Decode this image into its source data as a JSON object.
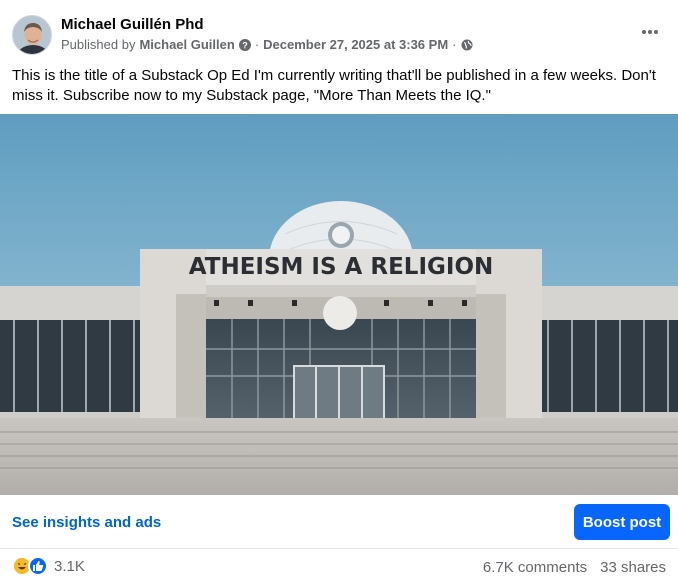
{
  "post": {
    "author": "Michael Guillén Phd",
    "published_by_prefix": "Published by",
    "published_by_name": "Michael Guillen",
    "separator": "·",
    "date": "December 27, 2025 at 3:36 PM",
    "text": "This is the title of a Substack Op Ed I'm currently writing that'll be published in a few weeks. Don't miss it. Subscribe now to my Substack page, \"More Than Meets the IQ.\"",
    "more_icon": "more-horizontal-icon",
    "privacy_icon": "globe-icon"
  },
  "photo": {
    "sign_text": "ATHEISM IS A RELIGION"
  },
  "actions": {
    "insights_label": "See insights and ads",
    "boost_label": "Boost post"
  },
  "stats": {
    "reaction_icons": [
      "haha-icon",
      "like-icon"
    ],
    "reaction_count": "3.1K",
    "comments": "6.7K comments",
    "shares": "33 shares"
  },
  "colors": {
    "link_blue": "#0064d1",
    "boost_blue": "#0866ff",
    "secondary_text": "#65676b",
    "sky": "#6fa6c4"
  }
}
